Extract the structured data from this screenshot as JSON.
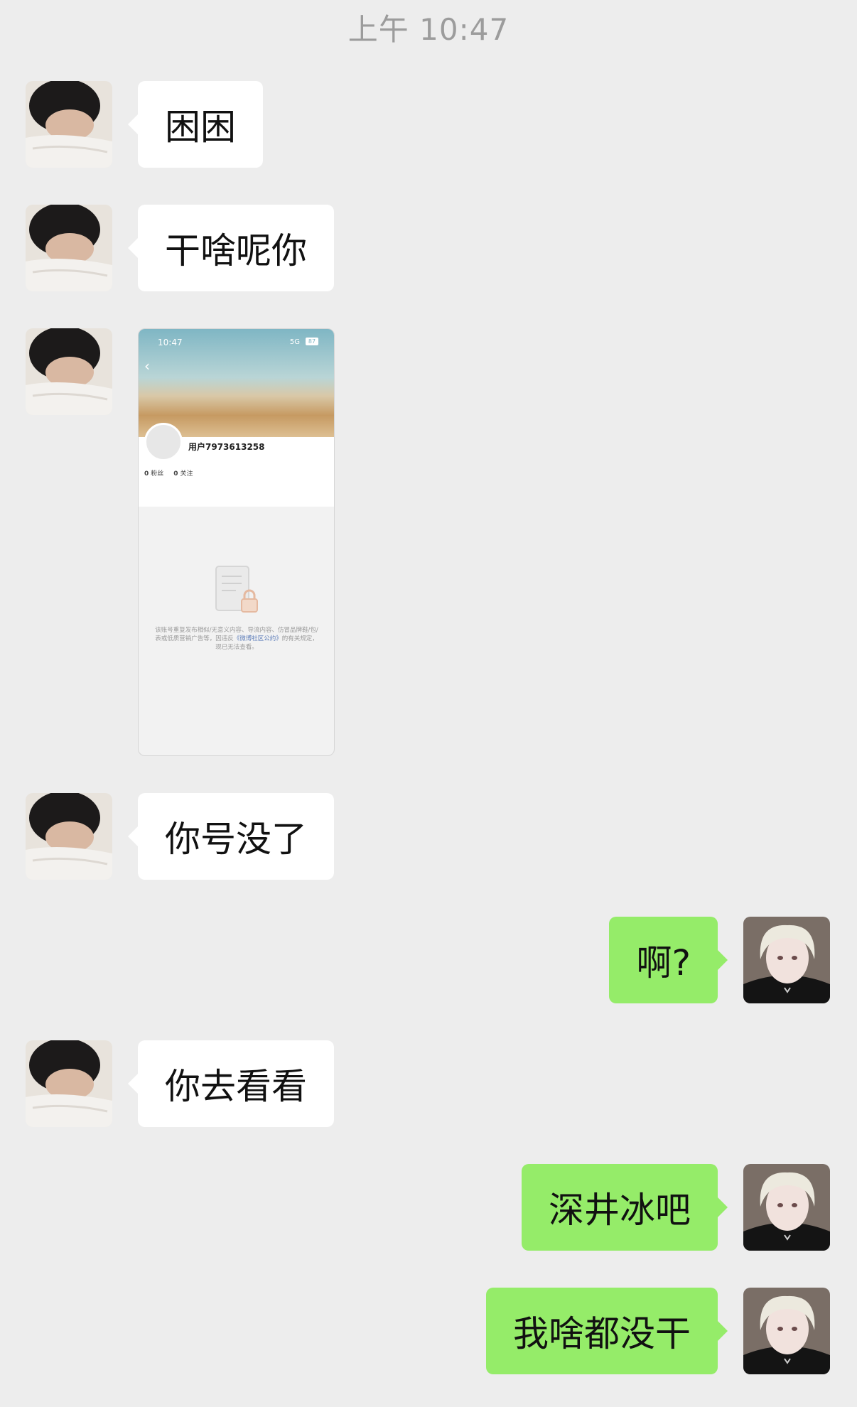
{
  "timestamp": "上午 10:47",
  "messages": [
    {
      "side": "left",
      "text": "困困"
    },
    {
      "side": "left",
      "text": "干啥呢你"
    },
    {
      "side": "left",
      "type": "image"
    },
    {
      "side": "left",
      "text": "你号没了"
    },
    {
      "side": "right",
      "text": "啊?"
    },
    {
      "side": "left",
      "text": "你去看看"
    },
    {
      "side": "right",
      "text": "深井冰吧"
    },
    {
      "side": "right",
      "text": "我啥都没干"
    }
  ],
  "screenshot": {
    "status_time": "10:47",
    "status_signal": "5G",
    "status_battery": "87",
    "back_glyph": "‹",
    "username": "用户7973613258",
    "fans_count": "0",
    "fans_label": "粉丝",
    "follow_count": "0",
    "follow_label": "关注",
    "notice_before": "该账号重复发布相似/无意义内容、导流内容、仿冒品牌鞋/包/表或低质营销广告等，因违反",
    "notice_link": "《微博社区公约》",
    "notice_after": "的有关规定，现已无法查看。"
  },
  "colors": {
    "background": "#EDEDED",
    "bubble_incoming": "#FFFFFF",
    "bubble_outgoing": "#95EC69",
    "timestamp": "#9C9C9C"
  },
  "icons": {
    "contact_avatar": "contact-avatar-sleeping-person",
    "self_avatar": "self-avatar-blonde-person",
    "lock": "lock-document-icon"
  }
}
